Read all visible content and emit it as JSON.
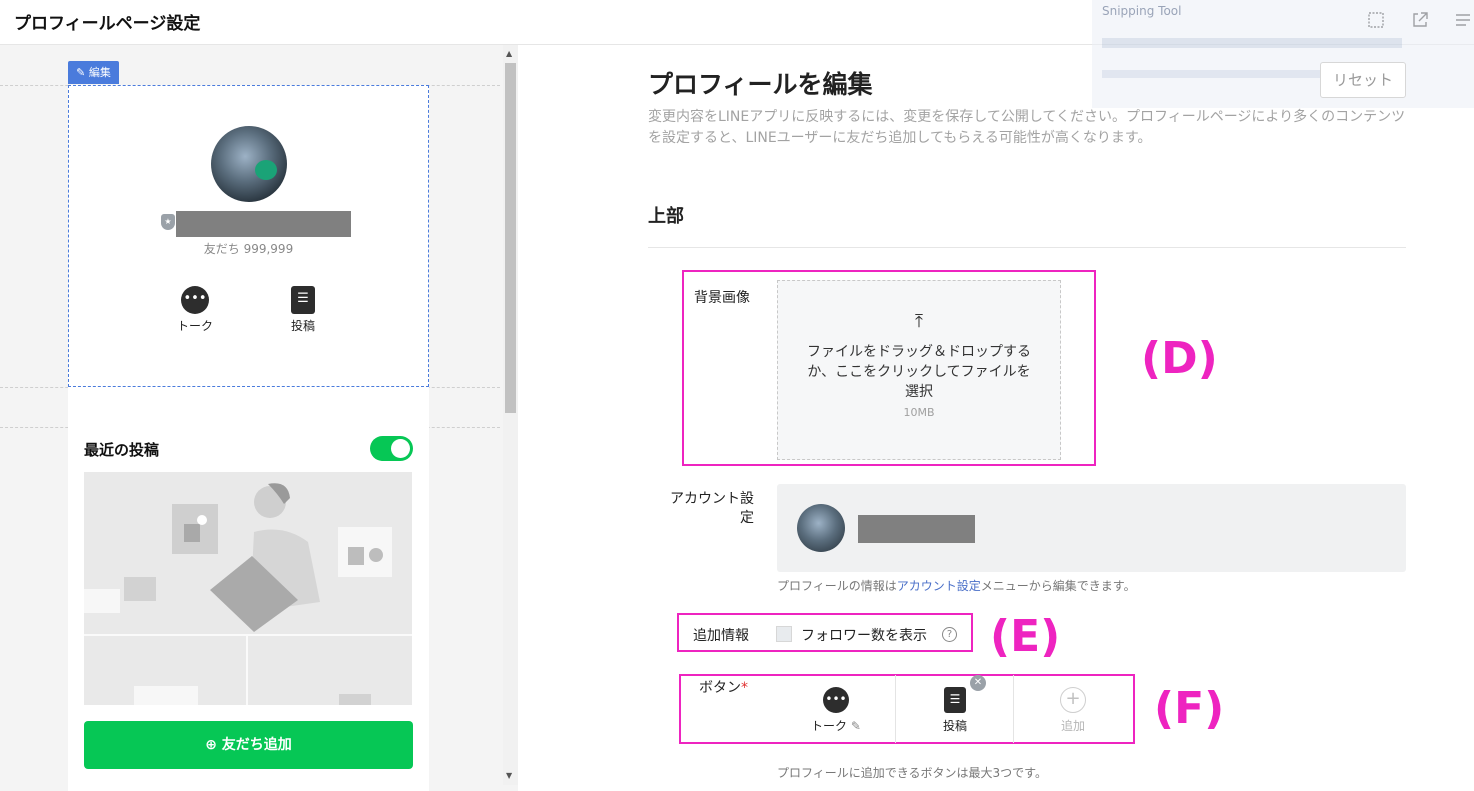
{
  "header": {
    "title": "プロフィールページ設定",
    "icons": [
      "layout-icon",
      "external-link-icon",
      "menu-icon"
    ]
  },
  "snipping_overlay": {
    "title": "Snipping Tool"
  },
  "preview": {
    "edit_tag": "✎ 編集",
    "friends_count": "友だち 999,999",
    "actions": [
      {
        "icon": "talk-icon",
        "label": "トーク"
      },
      {
        "icon": "post-icon",
        "label": "投稿"
      }
    ],
    "recent_posts": {
      "title": "最近の投稿",
      "enabled": true
    },
    "add_friend_button": "友だち追加"
  },
  "editor": {
    "title": "プロフィールを編集",
    "description": "変更内容をLINEアプリに反映するには、変更を保存して公開してください。プロフィールページにより多くのコンテンツを設定すると、LINEユーザーに友だち追加してもらえる可能性が高くなります。",
    "reset_button": "リセット",
    "section_top": "上部",
    "background_image": {
      "label": "背景画像",
      "upload_text": "ファイルをドラッグ＆ドロップするか、ここをクリックしてファイルを選択",
      "size_limit": "10MB"
    },
    "account_settings": {
      "label": "アカウント設定",
      "hint_prefix": "プロフィールの情報は",
      "hint_link": "アカウント設定",
      "hint_suffix": "メニューから編集できます。"
    },
    "additional_info": {
      "label": "追加情報",
      "checkbox_label": "フォロワー数を表示",
      "checked": false
    },
    "buttons": {
      "label": "ボタン",
      "required_mark": "*",
      "items": [
        {
          "label": "トーク",
          "icon": "talk-icon"
        },
        {
          "label": "投稿",
          "icon": "post-icon"
        },
        {
          "label": "追加",
          "icon": "plus-icon"
        }
      ],
      "hint": "プロフィールに追加できるボタンは最大3つです。"
    }
  },
  "annotations": {
    "d": "(D)",
    "e": "(E)",
    "f": "(F)"
  },
  "colors": {
    "line_green": "#06c755",
    "annotation_pink": "#ee24c0",
    "edit_blue": "#4a7bdc"
  }
}
